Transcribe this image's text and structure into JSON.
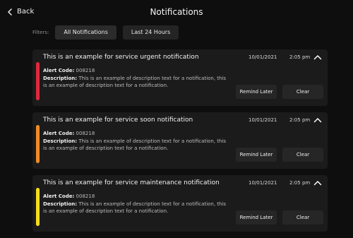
{
  "header": {
    "back_label": "Back",
    "title": "Notifications"
  },
  "filters": {
    "label": "Filters:",
    "options": [
      "All Notifications",
      "Last 24 Hours"
    ]
  },
  "notifications": [
    {
      "title": "This is an example for service urgent notification",
      "date": "10/01/2021",
      "time": "2:05 pm",
      "alert_label": "Alert Code:",
      "alert_code": "008218",
      "desc_label": "Description:",
      "description": "This is an example of description text for a notification, this is an example of description text for a notification.",
      "remind_label": "Remind Later",
      "clear_label": "Clear",
      "color": "#e0283c"
    },
    {
      "title": "This is an example for service soon notification",
      "date": "10/01/2021",
      "time": "2:05 pm",
      "alert_label": "Alert Code:",
      "alert_code": "008218",
      "desc_label": "Description:",
      "description": "This is an example of description text for a notification, this is an example of description text for a notification.",
      "remind_label": "Remind Later",
      "clear_label": "Clear",
      "color": "#f08a2a"
    },
    {
      "title": "This is an example for service maintenance notification",
      "date": "10/01/2021",
      "time": "2:05 pm",
      "alert_label": "Alert Code:",
      "alert_code": "008218",
      "desc_label": "Description:",
      "description": "This is an example of description text for a notification, this is an example of description text for a notification.",
      "remind_label": "Remind Later",
      "clear_label": "Clear",
      "color": "#f5dc1e"
    }
  ]
}
